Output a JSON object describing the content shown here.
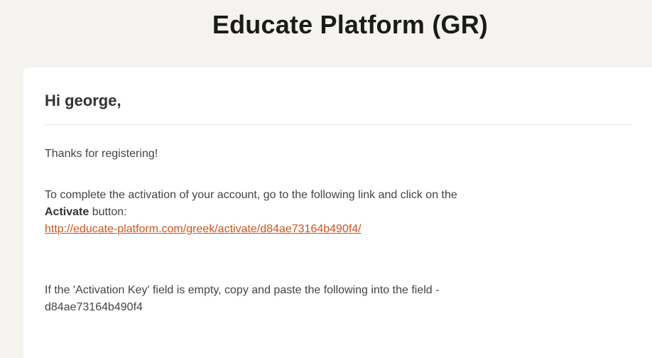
{
  "header": {
    "title": "Educate Platform (GR)"
  },
  "email": {
    "greeting": "Hi george,",
    "thanks": "Thanks for registering!",
    "activation_text_before": "To complete the activation of your account, go to the following link and click on the",
    "activate_word": "Activate",
    "activation_text_after": " button:",
    "activation_link": "http://educate-platform.com/greek/activate/d84ae73164b490f4/",
    "key_instruction": "If the 'Activation Key' field is empty, copy and paste the following into the field -",
    "activation_key": "d84ae73164b490f4"
  },
  "colors": {
    "background": "#f5f3f0",
    "card": "#ffffff",
    "link": "#d4531c"
  }
}
